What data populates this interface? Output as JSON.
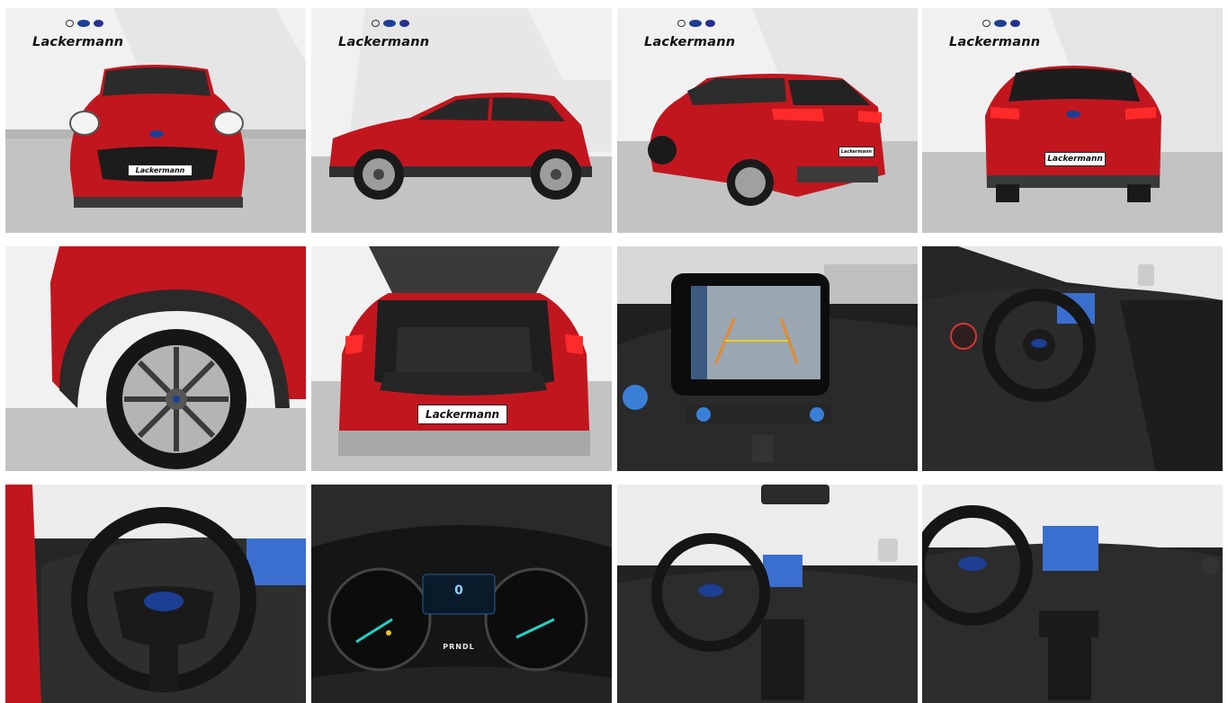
{
  "brand": {
    "dealer_logo_text": "Lackermann",
    "partner_marks": [
      "opel-icon",
      "ford-icon",
      "hyundai-icon"
    ]
  },
  "plate_text": "Lackermann",
  "colors": {
    "car_red": "#c2161f",
    "floor_grey": "#bdbdbd",
    "wall_white": "#f2f2f2",
    "cabin_dark": "#1e1e1e"
  },
  "dashboard": {
    "cluster_gear": "PRNDL",
    "cluster_speed": "0"
  },
  "photos": [
    {
      "name": "photo-front-view"
    },
    {
      "name": "photo-side-view"
    },
    {
      "name": "photo-rear-three-quarter-view"
    },
    {
      "name": "photo-rear-view"
    },
    {
      "name": "photo-wheel-detail"
    },
    {
      "name": "photo-open-trunk"
    },
    {
      "name": "photo-infotainment-rear-camera"
    },
    {
      "name": "photo-interior-dashboard-angle"
    },
    {
      "name": "photo-steering-wheel"
    },
    {
      "name": "photo-instrument-cluster"
    },
    {
      "name": "photo-cockpit-wide"
    },
    {
      "name": "photo-cockpit-center-console"
    }
  ]
}
